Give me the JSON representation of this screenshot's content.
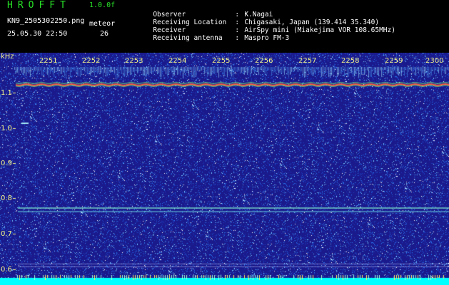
{
  "header": {
    "app_name": "HROFFT",
    "version": "1.0.0f",
    "filename": "KN9_2505302250.png",
    "meteor_label": "meteor",
    "datetime": "25.05.30 22:50",
    "meteor_count": "26"
  },
  "metadata": [
    {
      "label": "Observer",
      "value": "K.Nagai"
    },
    {
      "label": "Receiving Location",
      "value": "Chigasaki, Japan (139.414 35.340)"
    },
    {
      "label": "Receiver",
      "value": "AirSpy mini (Miakejima VOR 108.65MHz)"
    },
    {
      "label": "Receiving antenna",
      "value": "Maspro FM-3"
    }
  ],
  "separator": ":",
  "axis": {
    "unit": "kHz",
    "time_ticks": [
      "2251",
      "2252",
      "2253",
      "2254",
      "2255",
      "2256",
      "2257",
      "2258",
      "2259",
      "2300"
    ],
    "freq_ticks": [
      "1.1",
      "1.0",
      "0.9",
      "0.8",
      "0.7",
      "0.6"
    ]
  },
  "colors": {
    "background": "#1a1a8c",
    "header_green": "#27e027",
    "tick_label": "#f2f28a",
    "bottom_band": "#00ffff",
    "carrier": "#ff5a3c"
  }
}
